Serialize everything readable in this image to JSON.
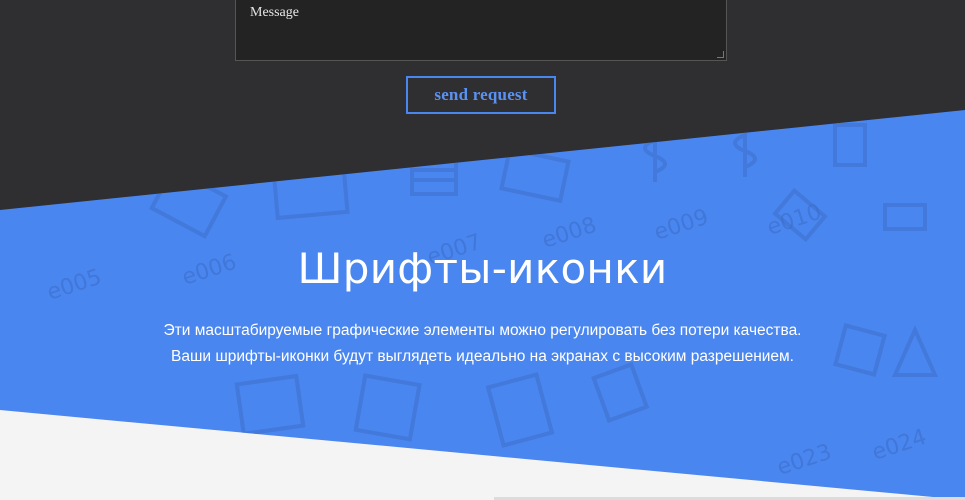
{
  "contact_form": {
    "message_placeholder": "Message",
    "send_label": "send request"
  },
  "icon_fonts": {
    "title": "Шрифты-иконки",
    "description_line1": "Эти масштабируемые графические элементы можно регулировать без потери качества.",
    "description_line2": "Ваши шрифты-иконки будут выглядеть идеально на экранах с высоким разрешением.",
    "watermark_codes": [
      "e005",
      "e006",
      "e007",
      "e008",
      "e009",
      "e010",
      "e023",
      "e024"
    ]
  },
  "colors": {
    "dark_background": "#2f2e30",
    "accent_blue": "#4a86f0",
    "light_background": "#f4f4f4"
  }
}
